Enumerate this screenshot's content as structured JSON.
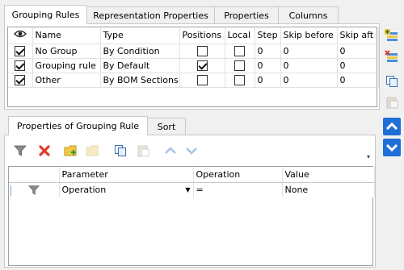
{
  "top_tabs": [
    "Grouping Rules",
    "Representation Properties",
    "Properties",
    "Columns"
  ],
  "rules_table": {
    "columns": [
      "",
      "Name",
      "Type",
      "Positions",
      "Local",
      "Step",
      "Skip before",
      "Skip aft"
    ],
    "rows": [
      {
        "visible": true,
        "name": "No Group",
        "type": "By Condition",
        "positions": false,
        "local": false,
        "step": "0",
        "skip_before": "0",
        "skip_after": "0"
      },
      {
        "visible": true,
        "name": "Grouping rule",
        "type": "By Default",
        "positions": true,
        "local": false,
        "step": "0",
        "skip_before": "0",
        "skip_after": "0"
      },
      {
        "visible": true,
        "name": "Other",
        "type": "By BOM Sections",
        "positions": false,
        "local": false,
        "step": "0",
        "skip_before": "0",
        "skip_after": "0"
      }
    ]
  },
  "bottom_tabs": [
    "Properties of Grouping Rule",
    "Sort"
  ],
  "params_table": {
    "columns": [
      "",
      "Parameter",
      "Operation",
      "Value"
    ],
    "rows": [
      {
        "icon": "filter-icon",
        "parameter": "Operation",
        "operation": "=",
        "value": "None"
      }
    ]
  },
  "icons": {
    "side": [
      "add-rule-icon",
      "delete-rule-icon",
      "copy-icon",
      "paste-icon",
      "move-up-icon",
      "move-down-icon"
    ],
    "toolbar": [
      "filter-icon",
      "delete-icon",
      "add-folder-icon",
      "folder-icon",
      "copy-icon",
      "paste-icon",
      "move-up-icon",
      "move-down-icon"
    ]
  },
  "colors": {
    "accent_blue": "#1f6fd6",
    "delete_red": "#e03b2b",
    "folder_yellow": "#f2c744"
  }
}
